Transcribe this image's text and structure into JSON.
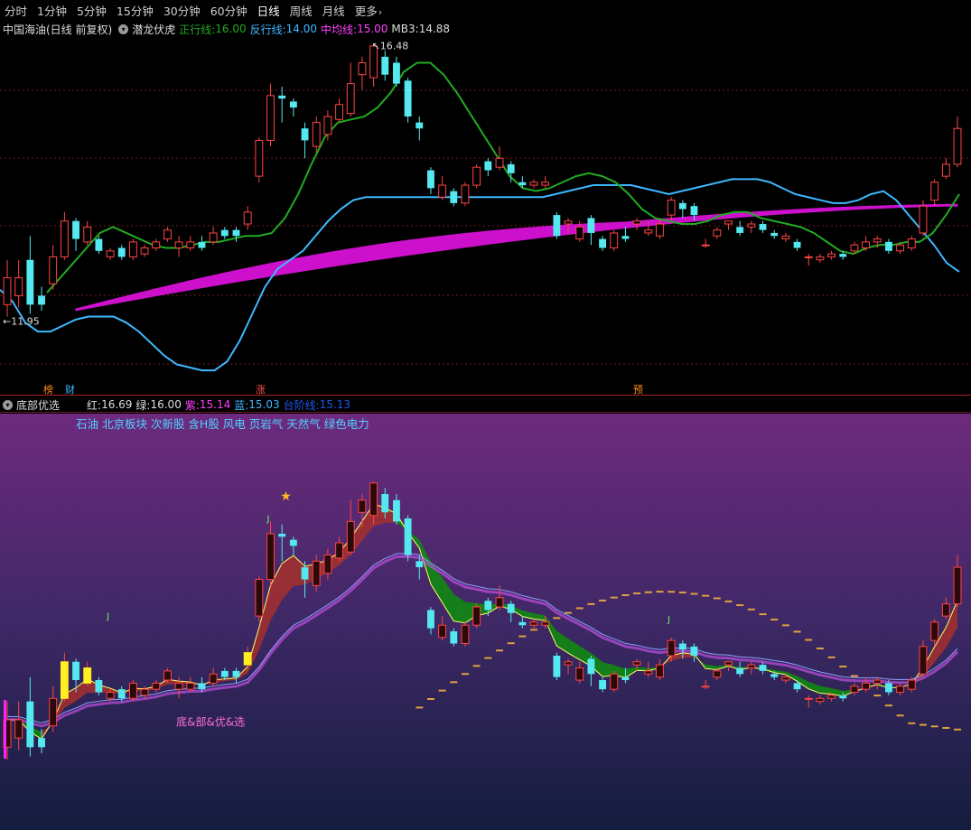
{
  "toolbar": {
    "items": [
      "分时",
      "1分钟",
      "5分钟",
      "15分钟",
      "30分钟",
      "60分钟",
      "日线",
      "周线",
      "月线",
      "更多"
    ],
    "active_index": 6
  },
  "top_legend": {
    "stock": "中国海油(日线 前复权)",
    "indicator": "潜龙伏虎",
    "zheng_label": "正行线:",
    "zheng_value": "16.00",
    "fan_label": "反行线:",
    "fan_value": "14.00",
    "zhong_label": "中均线:",
    "zhong_value": "15.00",
    "mb3_label": "MB3:",
    "mb3_value": "14.88"
  },
  "bottom_legend": {
    "indicator": "底部优选",
    "hong_label": "红:",
    "hong_value": "16.69",
    "lv_label": "绿:",
    "lv_value": "16.00",
    "zi_label": "紫:",
    "zi_value": "15.14",
    "lan_label": "蓝:",
    "lan_value": "15.03",
    "tai_label": "台阶线:",
    "tai_value": "15.13"
  },
  "sectors": "石油 北京板块 次新股 含H股 风电 页岩气 天然气 绿色电力",
  "event_markers": [
    {
      "text": "榜",
      "color": "#ff8c1a"
    },
    {
      "text": "财",
      "color": "#3fb8ff"
    },
    {
      "text": "涨",
      "color": "#ff5050"
    },
    {
      "text": "预",
      "color": "#ff8c1a"
    }
  ],
  "bottom_annotation": "底&部&优&选",
  "bottom_j_labels": [
    "J",
    "J",
    "J"
  ],
  "colors": {
    "up": "#ff4444",
    "down": "#55e8f0",
    "zheng": "#22aa22",
    "fan": "#3fb8ff",
    "zhong": "#cc10cc",
    "green_text": "#22cc22",
    "blue_text": "#3fb8ff",
    "magenta_text": "#ff40ff",
    "white_text": "#dddddd"
  },
  "chart_data": {
    "type": "candlestick",
    "symbol": "中国海油",
    "period": "日线",
    "high_label": "16.48",
    "low_label": "11.95",
    "candles": [
      [
        12.15,
        12.6,
        11.95,
        12.9
      ],
      [
        12.3,
        12.6,
        12.1,
        12.9
      ],
      [
        12.9,
        12.15,
        12.0,
        13.3
      ],
      [
        12.3,
        12.15,
        12.05,
        12.45
      ],
      [
        12.5,
        12.95,
        12.4,
        13.15
      ],
      [
        12.95,
        13.55,
        12.9,
        13.7
      ],
      [
        13.55,
        13.25,
        13.05,
        13.6
      ],
      [
        13.2,
        13.45,
        13.15,
        13.55
      ],
      [
        13.25,
        13.05,
        13.0,
        13.3
      ],
      [
        12.95,
        13.05,
        12.9,
        13.1
      ],
      [
        13.1,
        12.95,
        12.9,
        13.15
      ],
      [
        12.95,
        13.2,
        12.9,
        13.25
      ],
      [
        13.0,
        13.1,
        12.95,
        13.15
      ],
      [
        13.1,
        13.2,
        13.05,
        13.25
      ],
      [
        13.25,
        13.4,
        13.2,
        13.45
      ],
      [
        13.1,
        13.2,
        12.95,
        13.3
      ],
      [
        13.1,
        13.2,
        13.05,
        13.3
      ],
      [
        13.2,
        13.1,
        13.05,
        13.3
      ],
      [
        13.2,
        13.35,
        13.15,
        13.45
      ],
      [
        13.4,
        13.3,
        13.25,
        13.45
      ],
      [
        13.4,
        13.3,
        13.2,
        13.45
      ],
      [
        13.5,
        13.7,
        13.4,
        13.8
      ],
      [
        14.3,
        14.9,
        14.2,
        14.95
      ],
      [
        14.9,
        15.65,
        14.8,
        15.85
      ],
      [
        15.65,
        15.6,
        15.2,
        15.8
      ],
      [
        15.55,
        15.45,
        15.3,
        15.6
      ],
      [
        15.1,
        14.9,
        14.6,
        15.2
      ],
      [
        14.8,
        15.2,
        14.7,
        15.3
      ],
      [
        15.0,
        15.3,
        14.9,
        15.4
      ],
      [
        15.25,
        15.5,
        15.2,
        15.6
      ],
      [
        15.35,
        15.85,
        15.3,
        16.2
      ],
      [
        16.0,
        16.2,
        15.75,
        16.3
      ],
      [
        15.95,
        16.48,
        15.8,
        16.5
      ],
      [
        16.3,
        16.0,
        15.9,
        16.4
      ],
      [
        16.2,
        15.85,
        15.8,
        16.3
      ],
      [
        15.9,
        15.3,
        15.2,
        15.95
      ],
      [
        15.2,
        15.1,
        14.9,
        15.3
      ],
      [
        14.4,
        14.1,
        14.0,
        14.45
      ],
      [
        13.95,
        14.15,
        13.9,
        14.3
      ],
      [
        14.05,
        13.85,
        13.8,
        14.1
      ],
      [
        13.85,
        14.15,
        13.8,
        14.2
      ],
      [
        14.15,
        14.45,
        14.1,
        14.5
      ],
      [
        14.55,
        14.4,
        14.3,
        14.6
      ],
      [
        14.45,
        14.6,
        14.4,
        14.8
      ],
      [
        14.5,
        14.35,
        14.2,
        14.55
      ],
      [
        14.2,
        14.15,
        14.1,
        14.3
      ],
      [
        14.15,
        14.2,
        14.1,
        14.25
      ],
      [
        14.15,
        14.2,
        14.1,
        14.3
      ],
      [
        13.65,
        13.3,
        13.25,
        13.7
      ],
      [
        13.5,
        13.55,
        13.35,
        13.6
      ],
      [
        13.25,
        13.45,
        13.2,
        13.55
      ],
      [
        13.6,
        13.35,
        13.15,
        13.65
      ],
      [
        13.25,
        13.1,
        13.05,
        13.3
      ],
      [
        13.1,
        13.35,
        13.05,
        13.4
      ],
      [
        13.3,
        13.25,
        13.2,
        13.45
      ],
      [
        13.5,
        13.55,
        13.4,
        13.6
      ],
      [
        13.35,
        13.4,
        13.3,
        13.55
      ],
      [
        13.3,
        13.5,
        13.25,
        13.6
      ],
      [
        13.65,
        13.9,
        13.55,
        13.95
      ],
      [
        13.85,
        13.75,
        13.6,
        13.9
      ],
      [
        13.8,
        13.65,
        13.55,
        13.85
      ],
      [
        13.15,
        13.15,
        13.1,
        13.25
      ],
      [
        13.3,
        13.4,
        13.25,
        13.45
      ],
      [
        13.5,
        13.55,
        13.4,
        13.55
      ],
      [
        13.45,
        13.35,
        13.3,
        13.55
      ],
      [
        13.45,
        13.5,
        13.35,
        13.55
      ],
      [
        13.5,
        13.4,
        13.35,
        13.55
      ],
      [
        13.35,
        13.3,
        13.25,
        13.4
      ],
      [
        13.25,
        13.3,
        13.2,
        13.35
      ],
      [
        13.2,
        13.1,
        13.05,
        13.25
      ],
      [
        12.95,
        12.95,
        12.8,
        13.0
      ],
      [
        12.9,
        12.95,
        12.85,
        13.0
      ],
      [
        12.95,
        13.0,
        12.9,
        13.05
      ],
      [
        13.0,
        12.95,
        12.9,
        13.05
      ],
      [
        13.05,
        13.15,
        13.0,
        13.2
      ],
      [
        13.1,
        13.2,
        13.05,
        13.3
      ],
      [
        13.2,
        13.25,
        13.1,
        13.3
      ],
      [
        13.2,
        13.05,
        13.0,
        13.25
      ],
      [
        13.05,
        13.15,
        13.0,
        13.2
      ],
      [
        13.1,
        13.25,
        13.05,
        13.3
      ],
      [
        13.35,
        13.8,
        13.3,
        13.9
      ],
      [
        13.9,
        14.2,
        13.8,
        14.25
      ],
      [
        14.3,
        14.5,
        14.25,
        14.6
      ],
      [
        14.5,
        15.1,
        14.45,
        15.3
      ]
    ],
    "zheng_line": [
      12.35,
      12.6,
      12.85,
      13.1,
      13.35,
      13.45,
      13.35,
      13.25,
      13.15,
      13.1,
      13.1,
      13.15,
      13.2,
      13.2,
      13.25,
      13.3,
      13.3,
      13.35,
      13.6,
      14.0,
      14.5,
      14.95,
      15.2,
      15.25,
      15.3,
      15.45,
      15.7,
      16.05,
      16.2,
      16.2,
      16.0,
      15.7,
      15.35,
      15.0,
      14.65,
      14.3,
      14.1,
      14.05,
      14.1,
      14.2,
      14.3,
      14.35,
      14.3,
      14.2,
      14.0,
      13.75,
      13.6,
      13.55,
      13.5,
      13.5,
      13.55,
      13.65,
      13.7,
      13.7,
      13.6,
      13.55,
      13.5,
      13.45,
      13.35,
      13.2,
      13.05,
      13.0,
      13.1,
      13.15,
      13.15,
      13.2,
      13.2,
      13.35,
      13.65,
      14.0
    ],
    "fan_line": [
      12.4,
      12.2,
      11.85,
      11.7,
      11.7,
      11.8,
      11.9,
      11.95,
      11.95,
      11.95,
      11.85,
      11.7,
      11.5,
      11.3,
      11.15,
      11.1,
      11.05,
      11.05,
      11.2,
      11.55,
      12.0,
      12.45,
      12.75,
      12.9,
      13.05,
      13.3,
      13.55,
      13.75,
      13.9,
      13.95,
      13.95,
      13.95,
      13.95,
      13.95,
      13.95,
      13.95,
      13.95,
      13.95,
      13.95,
      13.95,
      13.95,
      13.95,
      13.95,
      13.95,
      14.0,
      14.05,
      14.1,
      14.15,
      14.15,
      14.15,
      14.15,
      14.1,
      14.05,
      14.0,
      14.05,
      14.1,
      14.15,
      14.2,
      14.25,
      14.25,
      14.25,
      14.2,
      14.1,
      14.0,
      13.95,
      13.9,
      13.85,
      13.85,
      13.9,
      14.0,
      14.05,
      13.9,
      13.65,
      13.4,
      13.15,
      12.85,
      12.7
    ]
  }
}
